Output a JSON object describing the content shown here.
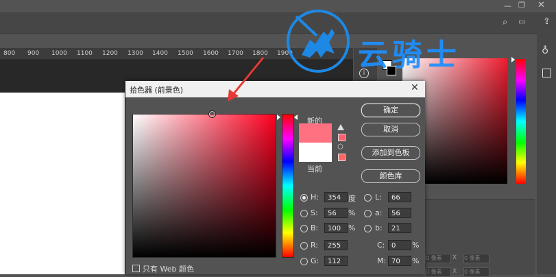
{
  "ruler": {
    "ticks": [
      "800",
      "900",
      "1000",
      "1100",
      "1200",
      "1300",
      "1400",
      "1500",
      "1600",
      "1700",
      "1800",
      "1900"
    ]
  },
  "watermark": {
    "text": "云骑士",
    "color": "#1e88e5"
  },
  "dialog": {
    "title": "拾色器 (前景色)",
    "close": "✕",
    "new_label": "新的",
    "current_label": "当前",
    "new_color": "#ff7080",
    "current_color": "#ffffff",
    "buttons": {
      "ok": "确定",
      "cancel": "取消",
      "add_to_swatches": "添加到色板",
      "color_libraries": "颜色库"
    },
    "hsb": {
      "h": {
        "label": "H:",
        "value": "354",
        "unit": "度"
      },
      "s": {
        "label": "S:",
        "value": "56",
        "unit": "%"
      },
      "b": {
        "label": "B:",
        "value": "100",
        "unit": "%"
      }
    },
    "lab": {
      "l": {
        "label": "L:",
        "value": "66"
      },
      "a": {
        "label": "a:",
        "value": "56"
      },
      "b": {
        "label": "b:",
        "value": "21"
      }
    },
    "rgb": {
      "r": {
        "label": "R:",
        "value": "255"
      },
      "g": {
        "label": "G:",
        "value": "112"
      }
    },
    "cmyk": {
      "c": {
        "label": "C:",
        "value": "0",
        "unit": "%"
      },
      "m": {
        "label": "M:",
        "value": "70",
        "unit": "%"
      }
    },
    "web_only": "只有 Web 颜色",
    "selected_mode": "H"
  },
  "lower_panel": {
    "x1": "X",
    "x2": "X",
    "field1": "0 像素",
    "field2": "0 像素",
    "field3": "0 像素",
    "field4": "0 像素"
  }
}
